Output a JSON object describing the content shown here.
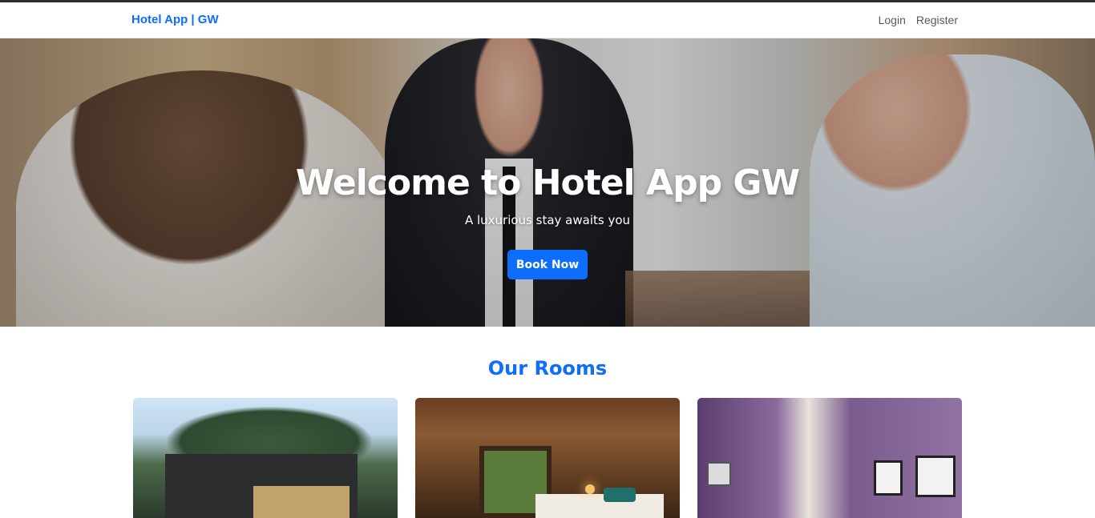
{
  "navbar": {
    "brand": "Hotel App | GW",
    "links": [
      {
        "label": "Login"
      },
      {
        "label": "Register"
      }
    ]
  },
  "hero": {
    "title": "Welcome to Hotel App GW",
    "subtitle": "A luxurious stay awaits you",
    "cta_label": "Book Now"
  },
  "rooms": {
    "heading": "Our Rooms",
    "cards": [
      {
        "image": "modern-house-exterior"
      },
      {
        "image": "warm-hotel-bedroom"
      },
      {
        "image": "purple-hotel-room"
      }
    ]
  },
  "colors": {
    "primary": "#0d6efd",
    "nav_text": "#555b61",
    "navbar_bg": "#ffffff",
    "top_border": "#2b3035"
  }
}
